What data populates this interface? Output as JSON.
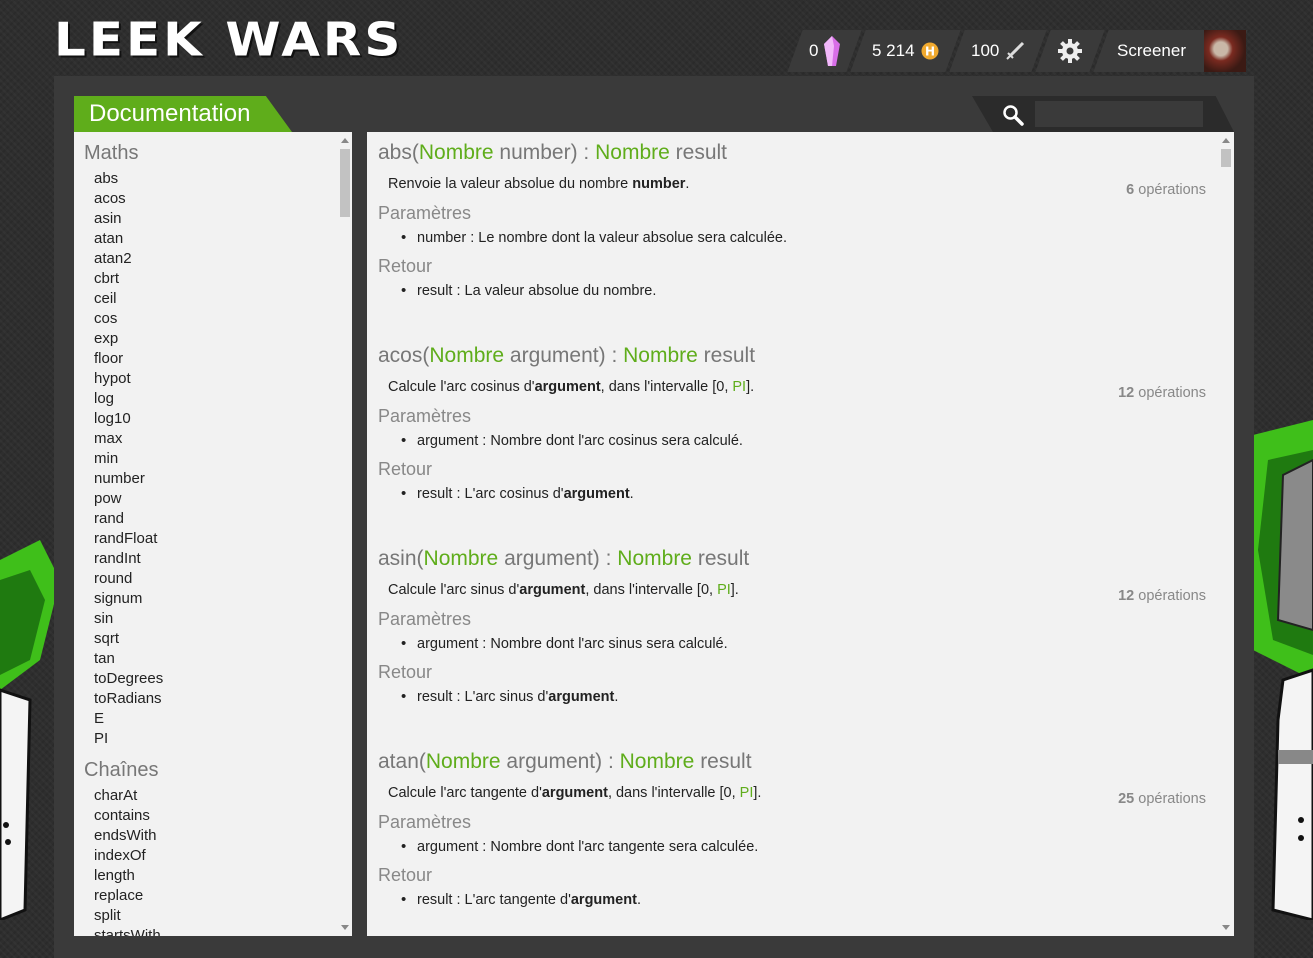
{
  "app": {
    "logo_text": "LEEK WARS"
  },
  "topbar": {
    "crystals": "0",
    "habs": "5 214",
    "fights": "100",
    "username": "Screener",
    "icons": [
      "crystal-icon",
      "hab-coin-icon",
      "sword-icon",
      "gear-icon",
      "avatar"
    ]
  },
  "page": {
    "tab_title": "Documentation"
  },
  "search": {
    "placeholder": "",
    "value": ""
  },
  "sidebar": {
    "sections": [
      {
        "title": "Maths",
        "items": [
          "abs",
          "acos",
          "asin",
          "atan",
          "atan2",
          "cbrt",
          "ceil",
          "cos",
          "exp",
          "floor",
          "hypot",
          "log",
          "log10",
          "max",
          "min",
          "number",
          "pow",
          "rand",
          "randFloat",
          "randInt",
          "round",
          "signum",
          "sin",
          "sqrt",
          "tan",
          "toDegrees",
          "toRadians",
          "E",
          "PI"
        ]
      },
      {
        "title": "Chaînes",
        "items": [
          "charAt",
          "contains",
          "endsWith",
          "indexOf",
          "length",
          "replace",
          "split",
          "startsWith"
        ]
      }
    ]
  },
  "labels": {
    "params": "Paramètres",
    "return": "Retour"
  },
  "functions": [
    {
      "name": "abs",
      "ptype": "Nombre",
      "pname": "number",
      "rtype": "Nombre",
      "rname": "result",
      "ops_count": "6",
      "ops_label": "opérations",
      "desc_before": "Renvoie la valeur absolue du nombre ",
      "desc_bold": "number",
      "desc_after": ".",
      "desc_pi": "",
      "desc_tail": "",
      "param_text": "number : Le nombre dont la valeur absolue sera calculée.",
      "return_before": "result : La valeur absolue du nombre.",
      "return_bold": "",
      "return_after": ""
    },
    {
      "name": "acos",
      "ptype": "Nombre",
      "pname": "argument",
      "rtype": "Nombre",
      "rname": "result",
      "ops_count": "12",
      "ops_label": "opérations",
      "desc_before": "Calcule l'arc cosinus d'",
      "desc_bold": "argument",
      "desc_after": ", dans l'intervalle [0, ",
      "desc_pi": "PI",
      "desc_tail": "].",
      "param_text": "argument : Nombre dont l'arc cosinus sera calculé.",
      "return_before": "result : L'arc cosinus d'",
      "return_bold": "argument",
      "return_after": "."
    },
    {
      "name": "asin",
      "ptype": "Nombre",
      "pname": "argument",
      "rtype": "Nombre",
      "rname": "result",
      "ops_count": "12",
      "ops_label": "opérations",
      "desc_before": "Calcule l'arc sinus d'",
      "desc_bold": "argument",
      "desc_after": ", dans l'intervalle [0, ",
      "desc_pi": "PI",
      "desc_tail": "].",
      "param_text": "argument : Nombre dont l'arc sinus sera calculé.",
      "return_before": "result : L'arc sinus d'",
      "return_bold": "argument",
      "return_after": "."
    },
    {
      "name": "atan",
      "ptype": "Nombre",
      "pname": "argument",
      "rtype": "Nombre",
      "rname": "result",
      "ops_count": "25",
      "ops_label": "opérations",
      "desc_before": "Calcule l'arc tangente d'",
      "desc_bold": "argument",
      "desc_after": ", dans l'intervalle [0, ",
      "desc_pi": "PI",
      "desc_tail": "].",
      "param_text": "argument : Nombre dont l'arc tangente sera calculée.",
      "return_before": "result : L'arc tangente d'",
      "return_bold": "argument",
      "return_after": "."
    }
  ],
  "colors": {
    "accent": "#5fad1b",
    "panel": "#f2f2f2",
    "background": "#2e2e2e"
  }
}
